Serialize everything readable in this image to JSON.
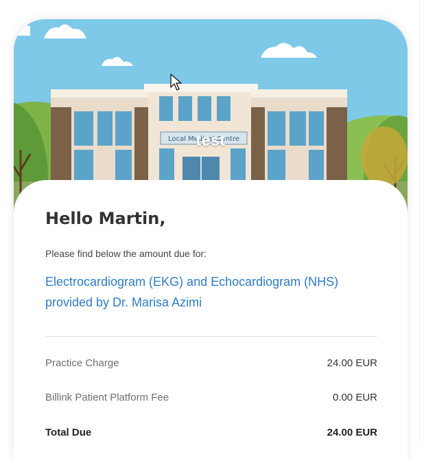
{
  "hero": {
    "building_sign": "Local Medical Centre",
    "caption": "test"
  },
  "greeting": "Hello Martin,",
  "intro": "Please find below the amount due for:",
  "service_description": "Electrocardiogram (EKG) and Echocardiogram (NHS) provided by Dr. Marisa Azimi",
  "charges": [
    {
      "label": "Practice Charge",
      "amount": "24.00 EUR"
    },
    {
      "label": "Billink Patient Platform Fee",
      "amount": "0.00 EUR"
    }
  ],
  "total": {
    "label": "Total Due",
    "amount": "24.00 EUR"
  },
  "colors": {
    "sky": "#7ec8e8",
    "link_blue": "#2d7cc6",
    "heading": "#333333"
  }
}
